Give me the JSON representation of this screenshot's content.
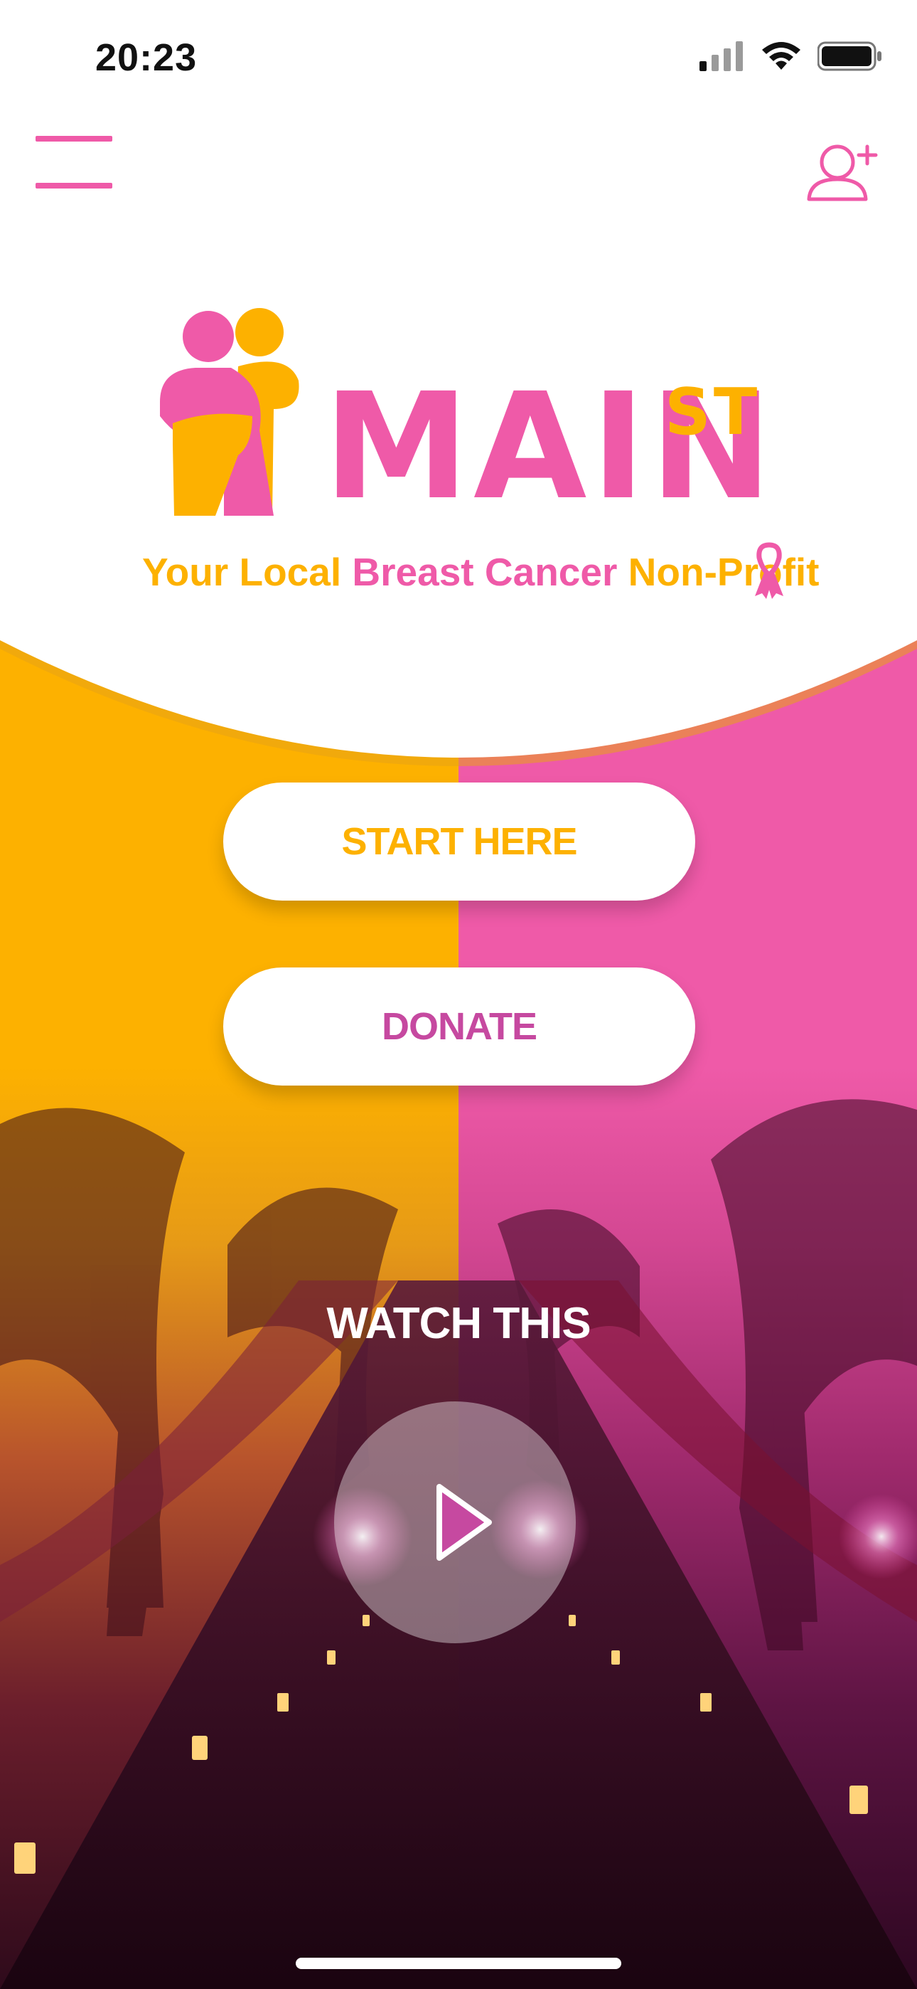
{
  "status_bar": {
    "time": "20:23",
    "icons": [
      "cellular-signal-icon",
      "wifi-icon",
      "battery-icon"
    ]
  },
  "header": {
    "menu_icon": "hamburger-menu-icon",
    "add_user_icon": "add-user-icon"
  },
  "logo": {
    "word": "MAIN",
    "superscript": "ST",
    "tagline_part1": "Your Local ",
    "tagline_part2": "Breast Cancer",
    "tagline_part3": " Non-Profit",
    "ribbon_icon": "pink-ribbon-icon"
  },
  "actions": {
    "start_label": "START HERE",
    "donate_label": "DONATE"
  },
  "video": {
    "heading": "WATCH THIS",
    "play_icon": "play-icon"
  },
  "colors": {
    "gold": "#FDB100",
    "pink": "#EF5AA8",
    "donate_text": "#C649A0"
  }
}
